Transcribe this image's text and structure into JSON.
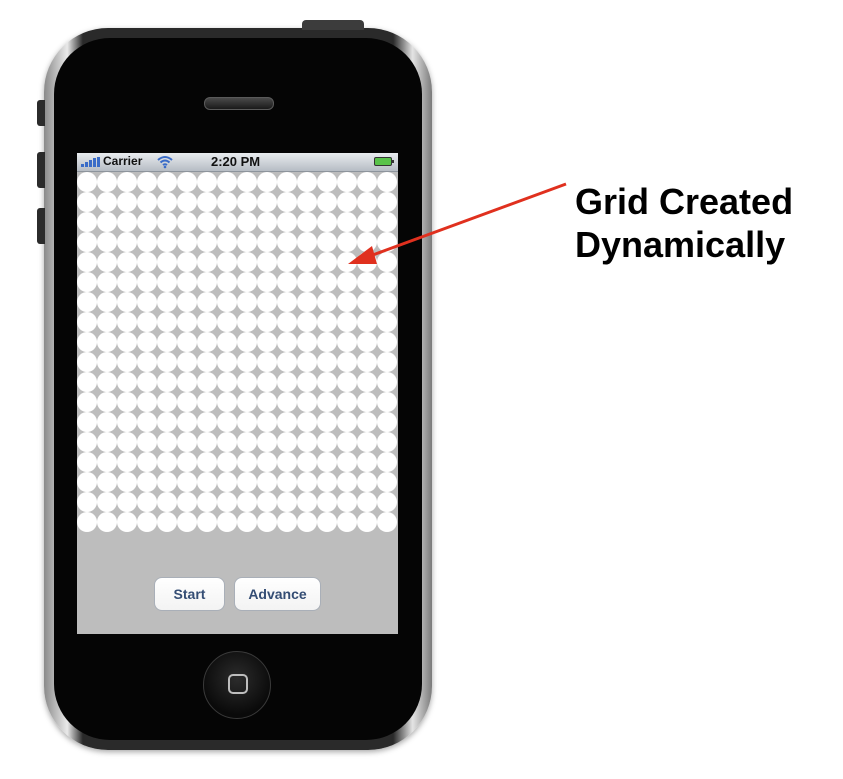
{
  "status_bar": {
    "carrier": "Carrier",
    "time": "2:20 PM",
    "signal_icon": "signal-bars-icon",
    "wifi_icon": "wifi-icon",
    "battery_icon": "battery-icon"
  },
  "grid": {
    "columns": 16,
    "rows": 18,
    "dot_color": "#ffffff",
    "background_color": "#bdbdbd"
  },
  "buttons": {
    "start_label": "Start",
    "advance_label": "Advance"
  },
  "annotation": {
    "line1": "Grid Created",
    "line2": "Dynamically",
    "arrow_color": "#e0301e"
  }
}
